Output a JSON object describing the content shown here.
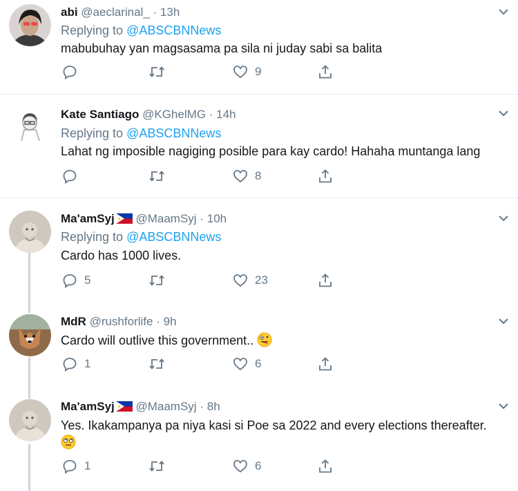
{
  "tweets": [
    {
      "name": "abi",
      "handle": "@aeclarinal_",
      "dot": "·",
      "time": "13h",
      "replying_label": "Replying to",
      "replying_to": "@ABSCBNNews",
      "text": "mabubuhay yan magsasama pa sila ni juday sabi sa balita",
      "replies": "",
      "likes": "9"
    },
    {
      "name": "Kate Santiago",
      "handle": "@KGhelMG",
      "dot": "·",
      "time": "14h",
      "replying_label": "Replying to",
      "replying_to": "@ABSCBNNews",
      "text": "Lahat ng imposible nagiging posible para kay cardo! Hahaha muntanga lang",
      "replies": "",
      "likes": "8"
    },
    {
      "name": "Ma'amSyj",
      "handle": "@MaamSyj",
      "dot": "·",
      "time": "10h",
      "replying_label": "Replying to",
      "replying_to": "@ABSCBNNews",
      "text": "Cardo has 1000 lives.",
      "replies": "5",
      "likes": "23"
    },
    {
      "name": "MdR",
      "handle": "@rushforlife",
      "dot": "·",
      "time": "9h",
      "text": "Cardo will outlive this government..",
      "replies": "1",
      "likes": "6"
    },
    {
      "name": "Ma'amSyj",
      "handle": "@MaamSyj",
      "dot": "·",
      "time": "8h",
      "text": "Yes. Ikakampanya pa niya kasi si Poe sa 2022 and every elections thereafter.",
      "replies": "1",
      "likes": "6"
    }
  ],
  "colors": {
    "link": "#1da1f2",
    "secondary": "#657786",
    "divider": "#e6ecf0",
    "thread": "#ccd6dd"
  },
  "icons": [
    "reply-icon",
    "retweet-icon",
    "like-icon",
    "share-icon",
    "chevron-down-icon",
    "philippines-flag-icon",
    "zany-face-emoji",
    "rolling-eyes-emoji"
  ]
}
